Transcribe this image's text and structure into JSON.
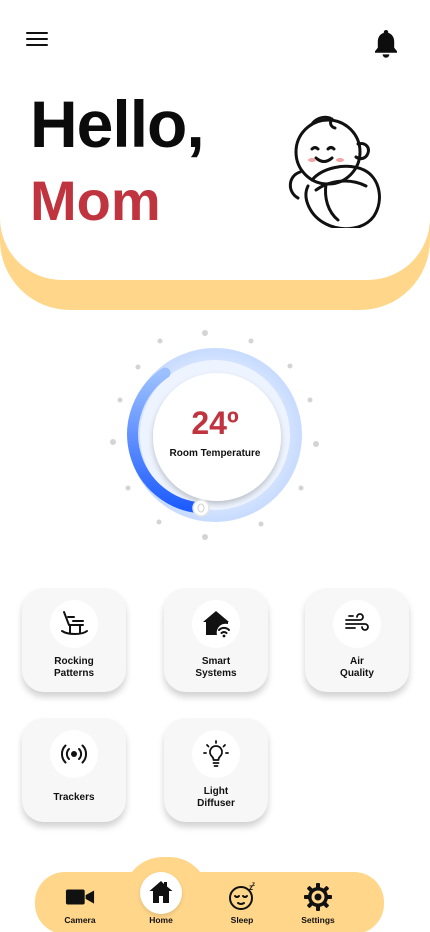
{
  "header": {
    "greeting": "Hello,",
    "name": "Mom",
    "menu_icon": "hamburger-menu-icon",
    "notification_icon": "bell-icon",
    "illustration": "swaddled-baby-illustration"
  },
  "thermostat": {
    "value": "24º",
    "label": "Room Temperature"
  },
  "features": [
    {
      "label_line1": "Rocking",
      "label_line2": "Patterns",
      "icon": "rocking-chair-icon"
    },
    {
      "label_line1": "Smart",
      "label_line2": "Systems",
      "icon": "smart-home-icon"
    },
    {
      "label_line1": "Air",
      "label_line2": "Quality",
      "icon": "wind-icon"
    },
    {
      "label_line1": "Trackers",
      "label_line2": "",
      "icon": "signal-tracker-icon"
    },
    {
      "label_line1": "Light",
      "label_line2": "Diffuser",
      "icon": "lightbulb-icon"
    }
  ],
  "nav": {
    "items": [
      {
        "label": "Camera",
        "icon": "video-camera-icon"
      },
      {
        "label": "Home",
        "icon": "home-icon",
        "active": true
      },
      {
        "label": "Sleep",
        "icon": "sleeping-face-icon"
      },
      {
        "label": "Settings",
        "icon": "gear-icon"
      }
    ]
  },
  "colors": {
    "accent_yellow": "#ffd68a",
    "accent_red": "#c0343f",
    "dial_blue": "#1e63ff"
  }
}
